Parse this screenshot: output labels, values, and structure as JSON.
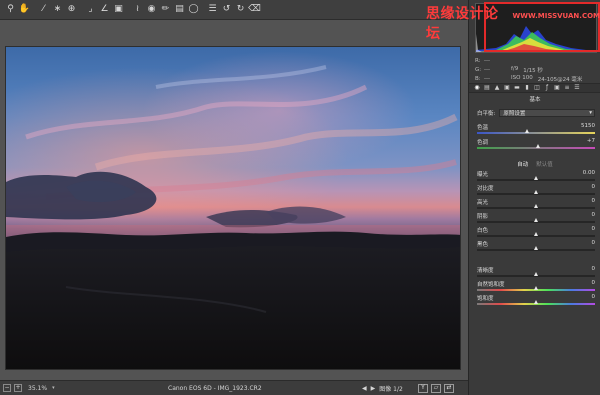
{
  "watermark": {
    "text_cn": "思缘设计论坛",
    "url": "WWW.MISSVUAN.COM"
  },
  "toolbar": {
    "icons": [
      "zoom-icon",
      "hand-icon",
      "white-balance-icon",
      "color-sampler-icon",
      "target-adjust-icon",
      "crop-icon",
      "straighten-icon",
      "transform-icon",
      "spot-removal-icon",
      "red-eye-icon",
      "adjustment-brush-icon",
      "graduated-filter-icon",
      "radial-filter-icon",
      "preferences-icon",
      "rotate-ccw-icon",
      "rotate-cw-icon",
      "trash-icon"
    ]
  },
  "info": {
    "r_label": "R:",
    "r_value": "---",
    "g_label": "G:",
    "g_value": "---",
    "b_label": "B:",
    "b_value": "---",
    "aperture": "f/9",
    "shutter": "1/15 秒",
    "iso": "ISO 100",
    "lens": "24-105@24 毫米"
  },
  "panel": {
    "section_title": "基本",
    "white_balance_label": "白平衡:",
    "white_balance_value": "原照设置",
    "auto_label": "自动",
    "default_label": "默认值"
  },
  "sliders": [
    {
      "label": "色温",
      "value": "5150",
      "level": 0.43
    },
    {
      "label": "色调",
      "value": "+7",
      "level": 0.52
    },
    {
      "label": "曝光",
      "value": "0.00",
      "level": 0.5
    },
    {
      "label": "对比度",
      "value": "0",
      "level": 0.5
    },
    {
      "label": "高光",
      "value": "0",
      "level": 0.5
    },
    {
      "label": "阴影",
      "value": "0",
      "level": 0.5
    },
    {
      "label": "白色",
      "value": "0",
      "level": 0.5
    },
    {
      "label": "黑色",
      "value": "0",
      "level": 0.5
    },
    {
      "label": "清晰度",
      "value": "0",
      "level": 0.5
    },
    {
      "label": "自然饱和度",
      "value": "0",
      "level": 0.5
    },
    {
      "label": "饱和度",
      "value": "0",
      "level": 0.5
    }
  ],
  "status": {
    "zoom": "35.1%",
    "filename": "Canon EOS 6D -  IMG_1923.CR2",
    "image_counter": "图像 1/2"
  },
  "colors": {
    "watermark": "#ff3b3b",
    "highlight": "#e32a2a",
    "panel_bg": "#3a3a3a"
  }
}
